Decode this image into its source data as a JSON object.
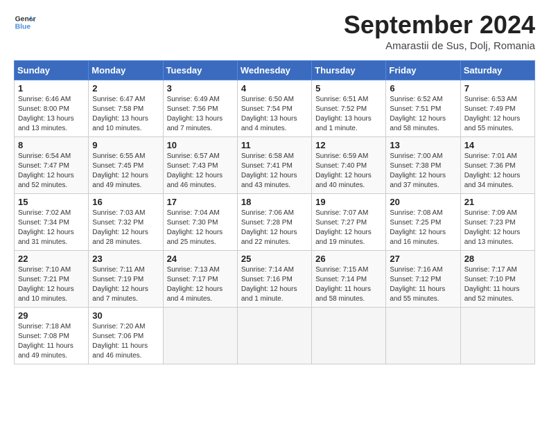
{
  "header": {
    "logo_line1": "General",
    "logo_line2": "Blue",
    "month_title": "September 2024",
    "subtitle": "Amarastii de Sus, Dolj, Romania"
  },
  "weekdays": [
    "Sunday",
    "Monday",
    "Tuesday",
    "Wednesday",
    "Thursday",
    "Friday",
    "Saturday"
  ],
  "weeks": [
    [
      {
        "day": "1",
        "info": "Sunrise: 6:46 AM\nSunset: 8:00 PM\nDaylight: 13 hours\nand 13 minutes."
      },
      {
        "day": "2",
        "info": "Sunrise: 6:47 AM\nSunset: 7:58 PM\nDaylight: 13 hours\nand 10 minutes."
      },
      {
        "day": "3",
        "info": "Sunrise: 6:49 AM\nSunset: 7:56 PM\nDaylight: 13 hours\nand 7 minutes."
      },
      {
        "day": "4",
        "info": "Sunrise: 6:50 AM\nSunset: 7:54 PM\nDaylight: 13 hours\nand 4 minutes."
      },
      {
        "day": "5",
        "info": "Sunrise: 6:51 AM\nSunset: 7:52 PM\nDaylight: 13 hours\nand 1 minute."
      },
      {
        "day": "6",
        "info": "Sunrise: 6:52 AM\nSunset: 7:51 PM\nDaylight: 12 hours\nand 58 minutes."
      },
      {
        "day": "7",
        "info": "Sunrise: 6:53 AM\nSunset: 7:49 PM\nDaylight: 12 hours\nand 55 minutes."
      }
    ],
    [
      {
        "day": "8",
        "info": "Sunrise: 6:54 AM\nSunset: 7:47 PM\nDaylight: 12 hours\nand 52 minutes."
      },
      {
        "day": "9",
        "info": "Sunrise: 6:55 AM\nSunset: 7:45 PM\nDaylight: 12 hours\nand 49 minutes."
      },
      {
        "day": "10",
        "info": "Sunrise: 6:57 AM\nSunset: 7:43 PM\nDaylight: 12 hours\nand 46 minutes."
      },
      {
        "day": "11",
        "info": "Sunrise: 6:58 AM\nSunset: 7:41 PM\nDaylight: 12 hours\nand 43 minutes."
      },
      {
        "day": "12",
        "info": "Sunrise: 6:59 AM\nSunset: 7:40 PM\nDaylight: 12 hours\nand 40 minutes."
      },
      {
        "day": "13",
        "info": "Sunrise: 7:00 AM\nSunset: 7:38 PM\nDaylight: 12 hours\nand 37 minutes."
      },
      {
        "day": "14",
        "info": "Sunrise: 7:01 AM\nSunset: 7:36 PM\nDaylight: 12 hours\nand 34 minutes."
      }
    ],
    [
      {
        "day": "15",
        "info": "Sunrise: 7:02 AM\nSunset: 7:34 PM\nDaylight: 12 hours\nand 31 minutes."
      },
      {
        "day": "16",
        "info": "Sunrise: 7:03 AM\nSunset: 7:32 PM\nDaylight: 12 hours\nand 28 minutes."
      },
      {
        "day": "17",
        "info": "Sunrise: 7:04 AM\nSunset: 7:30 PM\nDaylight: 12 hours\nand 25 minutes."
      },
      {
        "day": "18",
        "info": "Sunrise: 7:06 AM\nSunset: 7:28 PM\nDaylight: 12 hours\nand 22 minutes."
      },
      {
        "day": "19",
        "info": "Sunrise: 7:07 AM\nSunset: 7:27 PM\nDaylight: 12 hours\nand 19 minutes."
      },
      {
        "day": "20",
        "info": "Sunrise: 7:08 AM\nSunset: 7:25 PM\nDaylight: 12 hours\nand 16 minutes."
      },
      {
        "day": "21",
        "info": "Sunrise: 7:09 AM\nSunset: 7:23 PM\nDaylight: 12 hours\nand 13 minutes."
      }
    ],
    [
      {
        "day": "22",
        "info": "Sunrise: 7:10 AM\nSunset: 7:21 PM\nDaylight: 12 hours\nand 10 minutes."
      },
      {
        "day": "23",
        "info": "Sunrise: 7:11 AM\nSunset: 7:19 PM\nDaylight: 12 hours\nand 7 minutes."
      },
      {
        "day": "24",
        "info": "Sunrise: 7:13 AM\nSunset: 7:17 PM\nDaylight: 12 hours\nand 4 minutes."
      },
      {
        "day": "25",
        "info": "Sunrise: 7:14 AM\nSunset: 7:16 PM\nDaylight: 12 hours\nand 1 minute."
      },
      {
        "day": "26",
        "info": "Sunrise: 7:15 AM\nSunset: 7:14 PM\nDaylight: 11 hours\nand 58 minutes."
      },
      {
        "day": "27",
        "info": "Sunrise: 7:16 AM\nSunset: 7:12 PM\nDaylight: 11 hours\nand 55 minutes."
      },
      {
        "day": "28",
        "info": "Sunrise: 7:17 AM\nSunset: 7:10 PM\nDaylight: 11 hours\nand 52 minutes."
      }
    ],
    [
      {
        "day": "29",
        "info": "Sunrise: 7:18 AM\nSunset: 7:08 PM\nDaylight: 11 hours\nand 49 minutes."
      },
      {
        "day": "30",
        "info": "Sunrise: 7:20 AM\nSunset: 7:06 PM\nDaylight: 11 hours\nand 46 minutes."
      },
      {
        "day": "",
        "info": ""
      },
      {
        "day": "",
        "info": ""
      },
      {
        "day": "",
        "info": ""
      },
      {
        "day": "",
        "info": ""
      },
      {
        "day": "",
        "info": ""
      }
    ]
  ]
}
